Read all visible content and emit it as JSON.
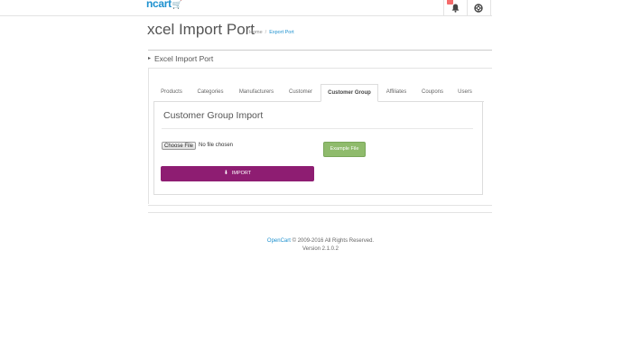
{
  "header": {
    "logo_text": "ncart",
    "logo_cart_glyph": "🛒",
    "notification_count": "",
    "icons": [
      "bell-icon",
      "life-ring-icon"
    ]
  },
  "page": {
    "title": "xcel Import Port",
    "breadcrumb": [
      {
        "label": "Home"
      },
      {
        "label": "Export Port"
      }
    ],
    "breadcrumb_sep": "/"
  },
  "panel": {
    "heading": "Excel Import Port",
    "caret_glyph": "▸"
  },
  "tabs": [
    {
      "label": "Products",
      "active": false
    },
    {
      "label": "Categories",
      "active": false
    },
    {
      "label": "Manufacturers",
      "active": false
    },
    {
      "label": "Customer",
      "active": false
    },
    {
      "label": "Customer Group",
      "active": true
    },
    {
      "label": "Affiliates",
      "active": false
    },
    {
      "label": "Coupons",
      "active": false
    },
    {
      "label": "Users",
      "active": false
    }
  ],
  "content": {
    "section_title": "Customer Group Import",
    "choose_file_label": "Choose File",
    "file_status": "No file chosen",
    "example_file_label": "Example File",
    "import_label": "IMPORT",
    "import_icon": "⬇"
  },
  "footer": {
    "brand_link": "OpenCart",
    "copyright": " © 2009-2016 All Rights Reserved.",
    "version": "Version 2.1.0.2"
  },
  "colors": {
    "accent_blue": "#1e91cf",
    "import_button": "#8e1d72",
    "example_button": "#8fbb6c"
  }
}
